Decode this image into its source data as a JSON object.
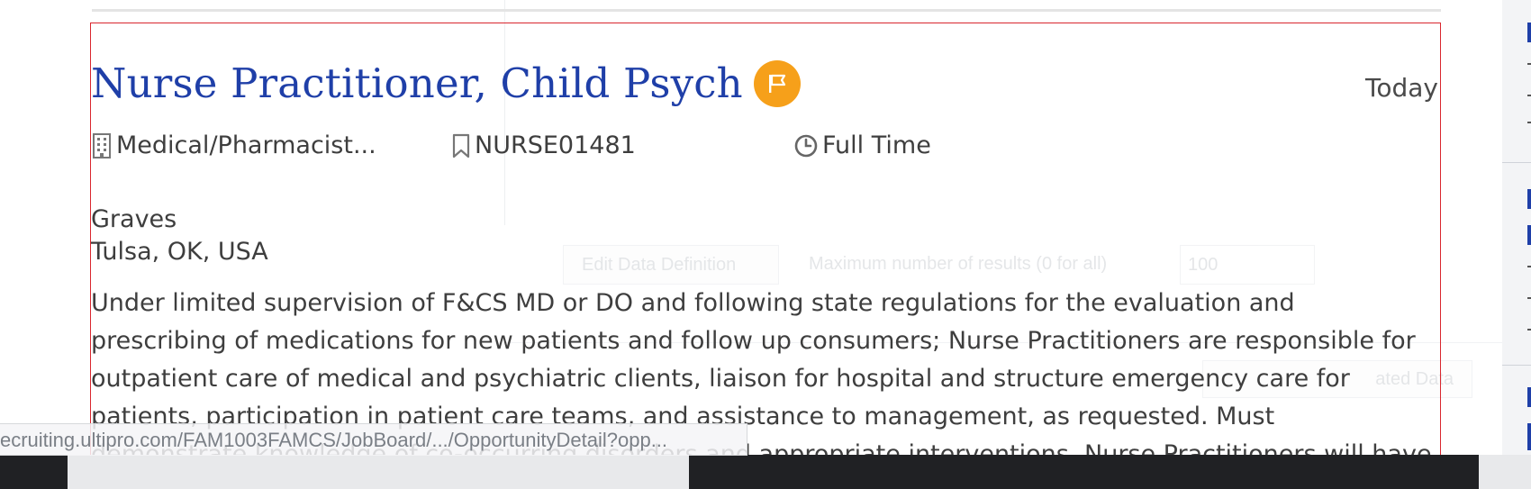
{
  "job": {
    "title": "Nurse Practitioner, Child Psych",
    "flag_icon": "flag-icon",
    "flag_color": "#f6a01a",
    "posted": "Today",
    "category": "Medical/Pharmacist...",
    "category_icon": "building-icon",
    "requisition": "NURSE01481",
    "requisition_icon": "bookmark-icon",
    "schedule": "Full Time",
    "schedule_icon": "clock-icon",
    "location_name": "Graves",
    "location_city": "Tulsa, OK, USA",
    "description": "Under limited supervision of F&CS MD or DO and following state regulations for the evaluation and prescribing of medications for new patients and follow up consumers; Nurse Practitioners are responsible for outpatient care of medical and psychiatric clients, liaison for hospital and structure emergency care for patients, participation in patient care teams, and assistance to management, as requested. Must demonstrate knowledge of co-occurring disorders and appropriate interventions. Nurse Practitioners will have prescribing"
  },
  "colors": {
    "title": "#1f3fa8",
    "card_border": "#d9272e",
    "text": "#3e3e3e"
  },
  "background": {
    "edit_button": "Edit Data Definition",
    "max_results_label": "Maximum number of results (0 for all)",
    "max_results_value": "100",
    "related_label": "ated Data"
  },
  "status_bar": {
    "url": "ecruiting.ultipro.com/FAM1003FAMCS/JobBoard/.../OpportunityDetail?opp..."
  }
}
